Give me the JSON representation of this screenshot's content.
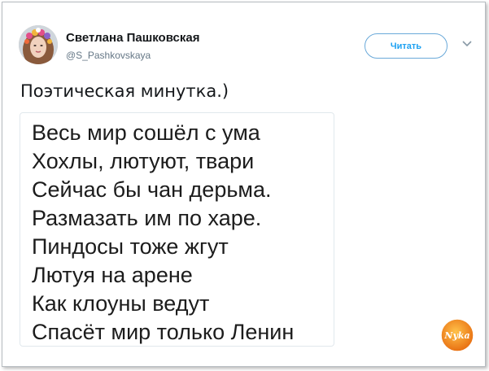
{
  "tweet": {
    "author_name": "Светлана Пашковская",
    "author_handle": "@S_Pashkovskaya",
    "follow_label": "Читать",
    "text": "Поэтическая минутка.)",
    "poem_lines": [
      "Весь мир сошёл с ума",
      "Хохлы, лютуют, твари",
      "Сейчас бы чан дерьма.",
      "Размазать им по харе.",
      "Пиндосы тоже жгут",
      "Лютуя на арене",
      "Как клоуны ведут",
      "Спасёт мир только Ленин"
    ]
  },
  "watermark": {
    "text": "Nyka",
    "icon": "site-logo-icon"
  },
  "icons": {
    "avatar": "avatar-photo",
    "menu": "chevron-down-icon"
  },
  "colors": {
    "accent": "#1da1f2",
    "text": "#14171a",
    "secondary_text": "#657786",
    "card_border": "#e1e8ed",
    "watermark_orange": "#f08a1c"
  }
}
